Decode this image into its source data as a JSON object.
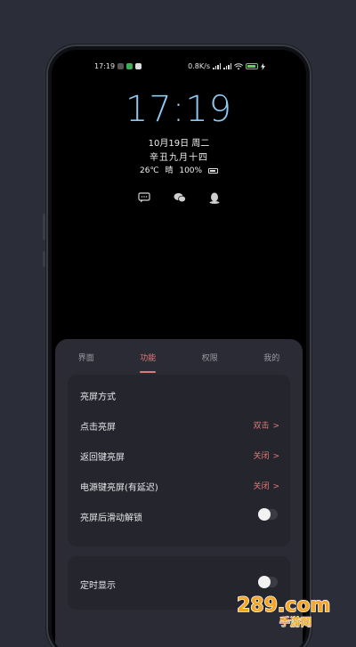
{
  "status_bar": {
    "time": "17:19",
    "network_speed": "0.8K/s",
    "battery_level": "100",
    "battery_color": "#5ad35a"
  },
  "lockscreen": {
    "clock": "17:19",
    "date": "10月19日 周二",
    "lunar": "辛丑九月十四",
    "temperature": "26℃",
    "weather": "晴",
    "battery_percent": "100%",
    "clock_color": "#8ec8f0",
    "notification_icons": [
      "message-icon",
      "wechat-icon",
      "qq-icon"
    ]
  },
  "tabs": [
    {
      "label": "界面",
      "active": false
    },
    {
      "label": "功能",
      "active": true
    },
    {
      "label": "权限",
      "active": false
    },
    {
      "label": "我的",
      "active": false
    }
  ],
  "settings": {
    "section_title": "亮屏方式",
    "rows": [
      {
        "label": "点击亮屏",
        "value": "双击",
        "chevron": ">"
      },
      {
        "label": "返回键亮屏",
        "value": "关闭",
        "chevron": ">"
      },
      {
        "label": "电源键亮屏(有延迟)",
        "value": "关闭",
        "chevron": ">"
      },
      {
        "label": "亮屏后滑动解锁",
        "toggle": false
      }
    ],
    "scheduled": {
      "label": "定时显示",
      "toggle": true
    }
  },
  "accent_color": "#e07a7a",
  "watermark": {
    "brand": "289.com",
    "subtitle": "手游网"
  }
}
